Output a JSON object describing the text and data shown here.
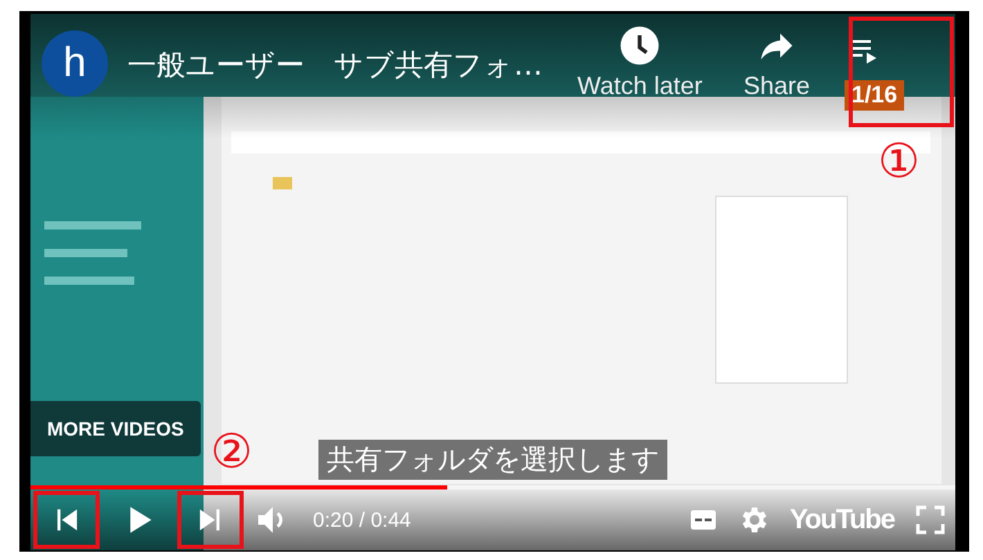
{
  "channel": {
    "initial": "h"
  },
  "title": "一般ユーザー　サブ共有フォ…",
  "actions": [
    {
      "kind": "watch_later",
      "label": "Watch later"
    },
    {
      "kind": "share",
      "label": "Share"
    }
  ],
  "playlist": {
    "position": "1/16",
    "highlighted": true
  },
  "more_videos": "MORE VIDEOS",
  "caption": "共有フォルダを選択します",
  "progress": {
    "level": 0.45
  },
  "controls": {
    "buttons": [
      {
        "kind": "previous",
        "highlighted": true
      },
      {
        "kind": "play",
        "highlighted": false
      },
      {
        "kind": "next",
        "highlighted": true
      },
      {
        "kind": "volume",
        "highlighted": false
      }
    ],
    "time": "0:20 / 0:44",
    "brand": "YouTube"
  },
  "annotations": [
    {
      "label": "①"
    },
    {
      "label": "②"
    }
  ]
}
